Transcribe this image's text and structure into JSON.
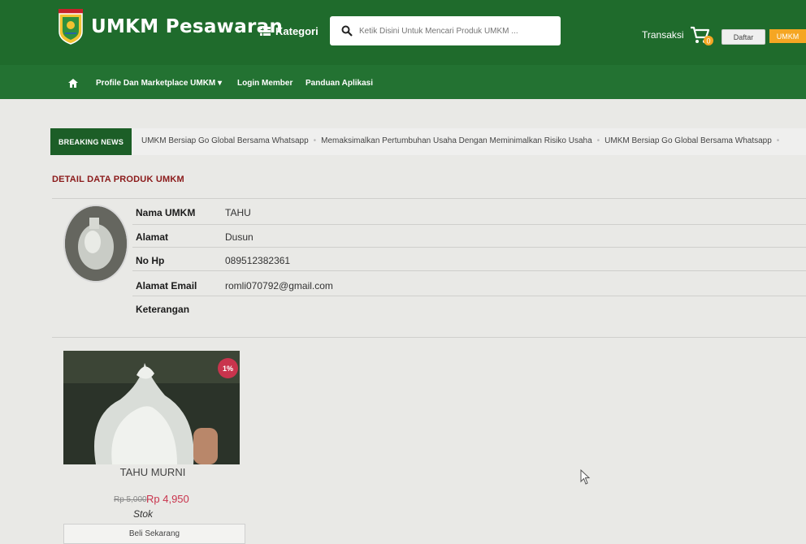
{
  "header": {
    "brand": "UMKM Pesawaran",
    "kategori_label": "Kategori",
    "search_placeholder": "Ketik Disini Untuk Mencari Produk UMKM ...",
    "transaksi_label": "Transaksi",
    "cart_count": "0",
    "daftar_label": "Daftar",
    "umkm_label": "UMKM",
    "colors": {
      "header_bg": "#1f6b2c",
      "accent_orange": "#f5a623"
    }
  },
  "nav": {
    "items": [
      {
        "label": "Profile Dan Marketplace UMKM ▾"
      },
      {
        "label": "Login Member"
      },
      {
        "label": "Panduan Aplikasi"
      }
    ]
  },
  "breaking_news": {
    "badge": "BREAKING NEWS",
    "items": [
      "UMKM Bersiap Go Global Bersama Whatsapp",
      "Memaksimalkan Pertumbuhan Usaha Dengan Meminimalkan Risiko Usaha",
      "UMKM Bersiap Go Global Bersama Whatsapp"
    ]
  },
  "detail": {
    "title": "DETAIL DATA PRODUK UMKM",
    "fields": [
      {
        "label": "Nama UMKM",
        "value": "TAHU"
      },
      {
        "label": "Alamat",
        "value": "Dusun"
      },
      {
        "label": "No Hp",
        "value": "089512382361"
      },
      {
        "label": "Alamat Email",
        "value": "romli070792@gmail.com"
      },
      {
        "label": "Keterangan",
        "value": ""
      }
    ]
  },
  "product": {
    "discount": "1%",
    "name": "TAHU MURNI",
    "old_price": "Rp 5,000",
    "new_price": "Rp 4,950",
    "stock_label": "Stok",
    "buy_label": "Beli Sekarang"
  }
}
